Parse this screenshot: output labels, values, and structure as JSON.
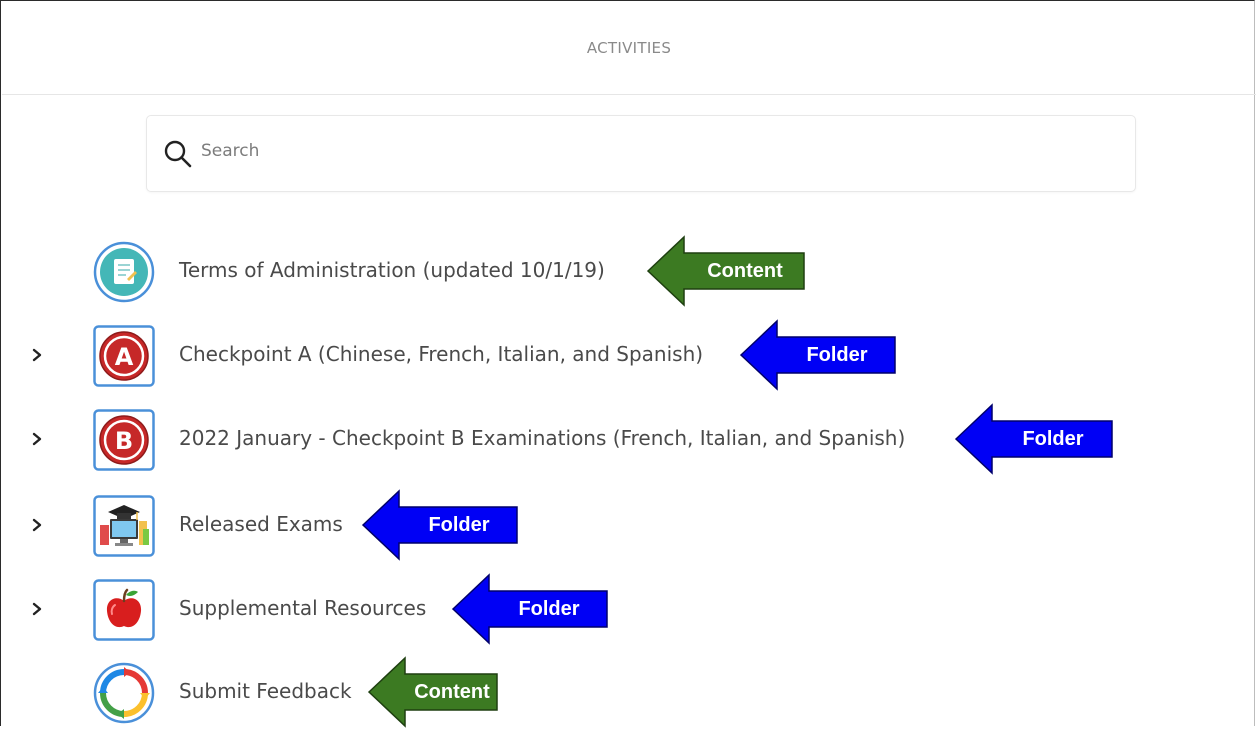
{
  "header": {
    "title": "ACTIVITIES"
  },
  "search": {
    "placeholder": "Search",
    "value": ""
  },
  "colors": {
    "content_tag": "#3c7a22",
    "folder_tag": "#0000f5",
    "icon_border": "#4a90d9"
  },
  "items": [
    {
      "label": "Terms of Administration (updated 10/1/19)",
      "icon": "document-icon",
      "expandable": false,
      "tag": "Content",
      "tag_kind": "content"
    },
    {
      "label": "Checkpoint A (Chinese, French, Italian, and Spanish)",
      "icon": "letter-a-icon",
      "expandable": true,
      "tag": "Folder",
      "tag_kind": "folder"
    },
    {
      "label": "2022 January - Checkpoint B Examinations (French, Italian, and Spanish)",
      "icon": "letter-b-icon",
      "expandable": true,
      "tag": "Folder",
      "tag_kind": "folder"
    },
    {
      "label": "Released Exams",
      "icon": "graduation-computer-icon",
      "expandable": true,
      "tag": "Folder",
      "tag_kind": "folder"
    },
    {
      "label": "Supplemental Resources",
      "icon": "apple-icon",
      "expandable": true,
      "tag": "Folder",
      "tag_kind": "folder"
    },
    {
      "label": "Submit Feedback",
      "icon": "feedback-cycle-icon",
      "expandable": false,
      "tag": "Content",
      "tag_kind": "content"
    }
  ]
}
